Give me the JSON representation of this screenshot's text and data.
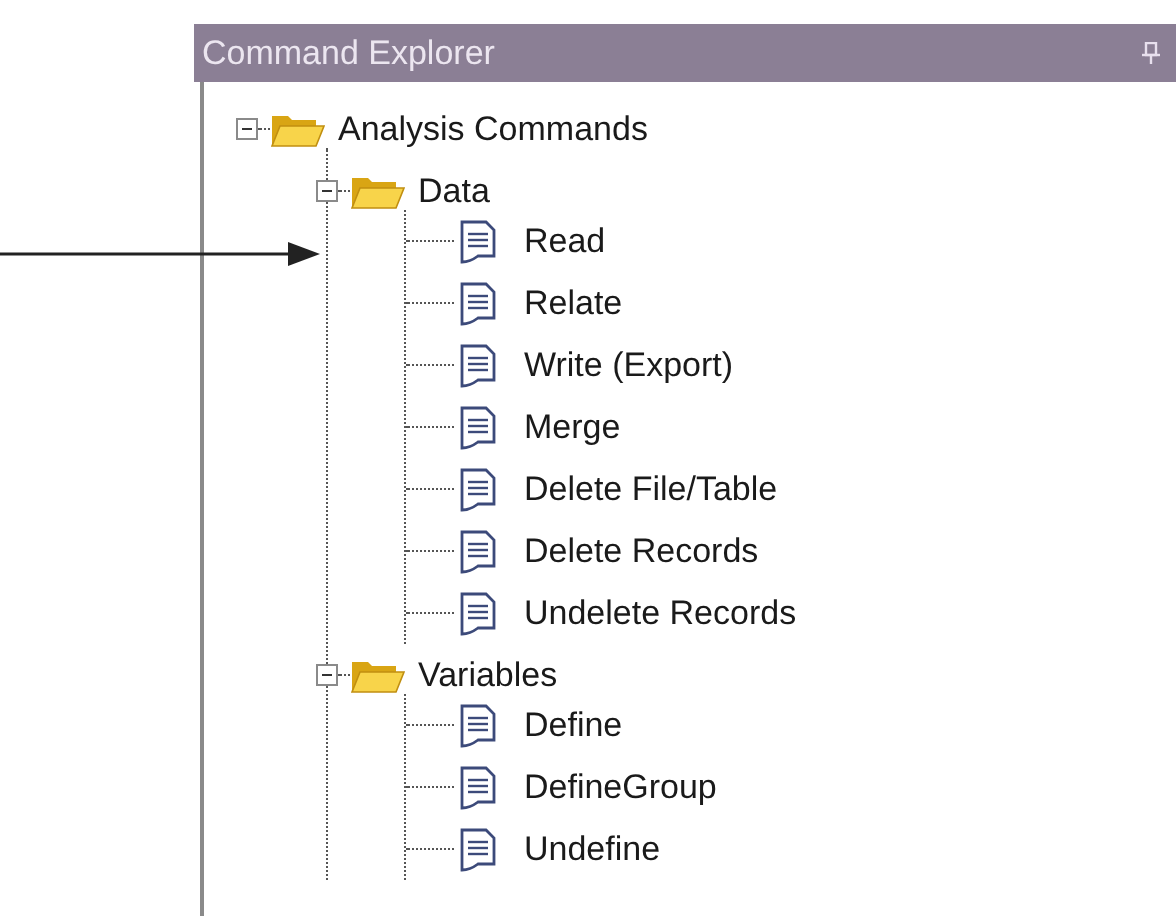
{
  "panel": {
    "title": "Command Explorer"
  },
  "tree": [
    {
      "label": "Analysis Commands",
      "kind": "folder",
      "expanded": true,
      "children": [
        {
          "label": "Data",
          "kind": "folder",
          "expanded": true,
          "children": [
            {
              "label": "Read",
              "kind": "command"
            },
            {
              "label": "Relate",
              "kind": "command"
            },
            {
              "label": "Write (Export)",
              "kind": "command"
            },
            {
              "label": "Merge",
              "kind": "command"
            },
            {
              "label": "Delete File/Table",
              "kind": "command"
            },
            {
              "label": "Delete Records",
              "kind": "command"
            },
            {
              "label": "Undelete Records",
              "kind": "command"
            }
          ]
        },
        {
          "label": "Variables",
          "kind": "folder",
          "expanded": true,
          "children": [
            {
              "label": "Define",
              "kind": "command"
            },
            {
              "label": "DefineGroup",
              "kind": "command"
            },
            {
              "label": "Undefine",
              "kind": "command"
            }
          ]
        }
      ]
    }
  ]
}
